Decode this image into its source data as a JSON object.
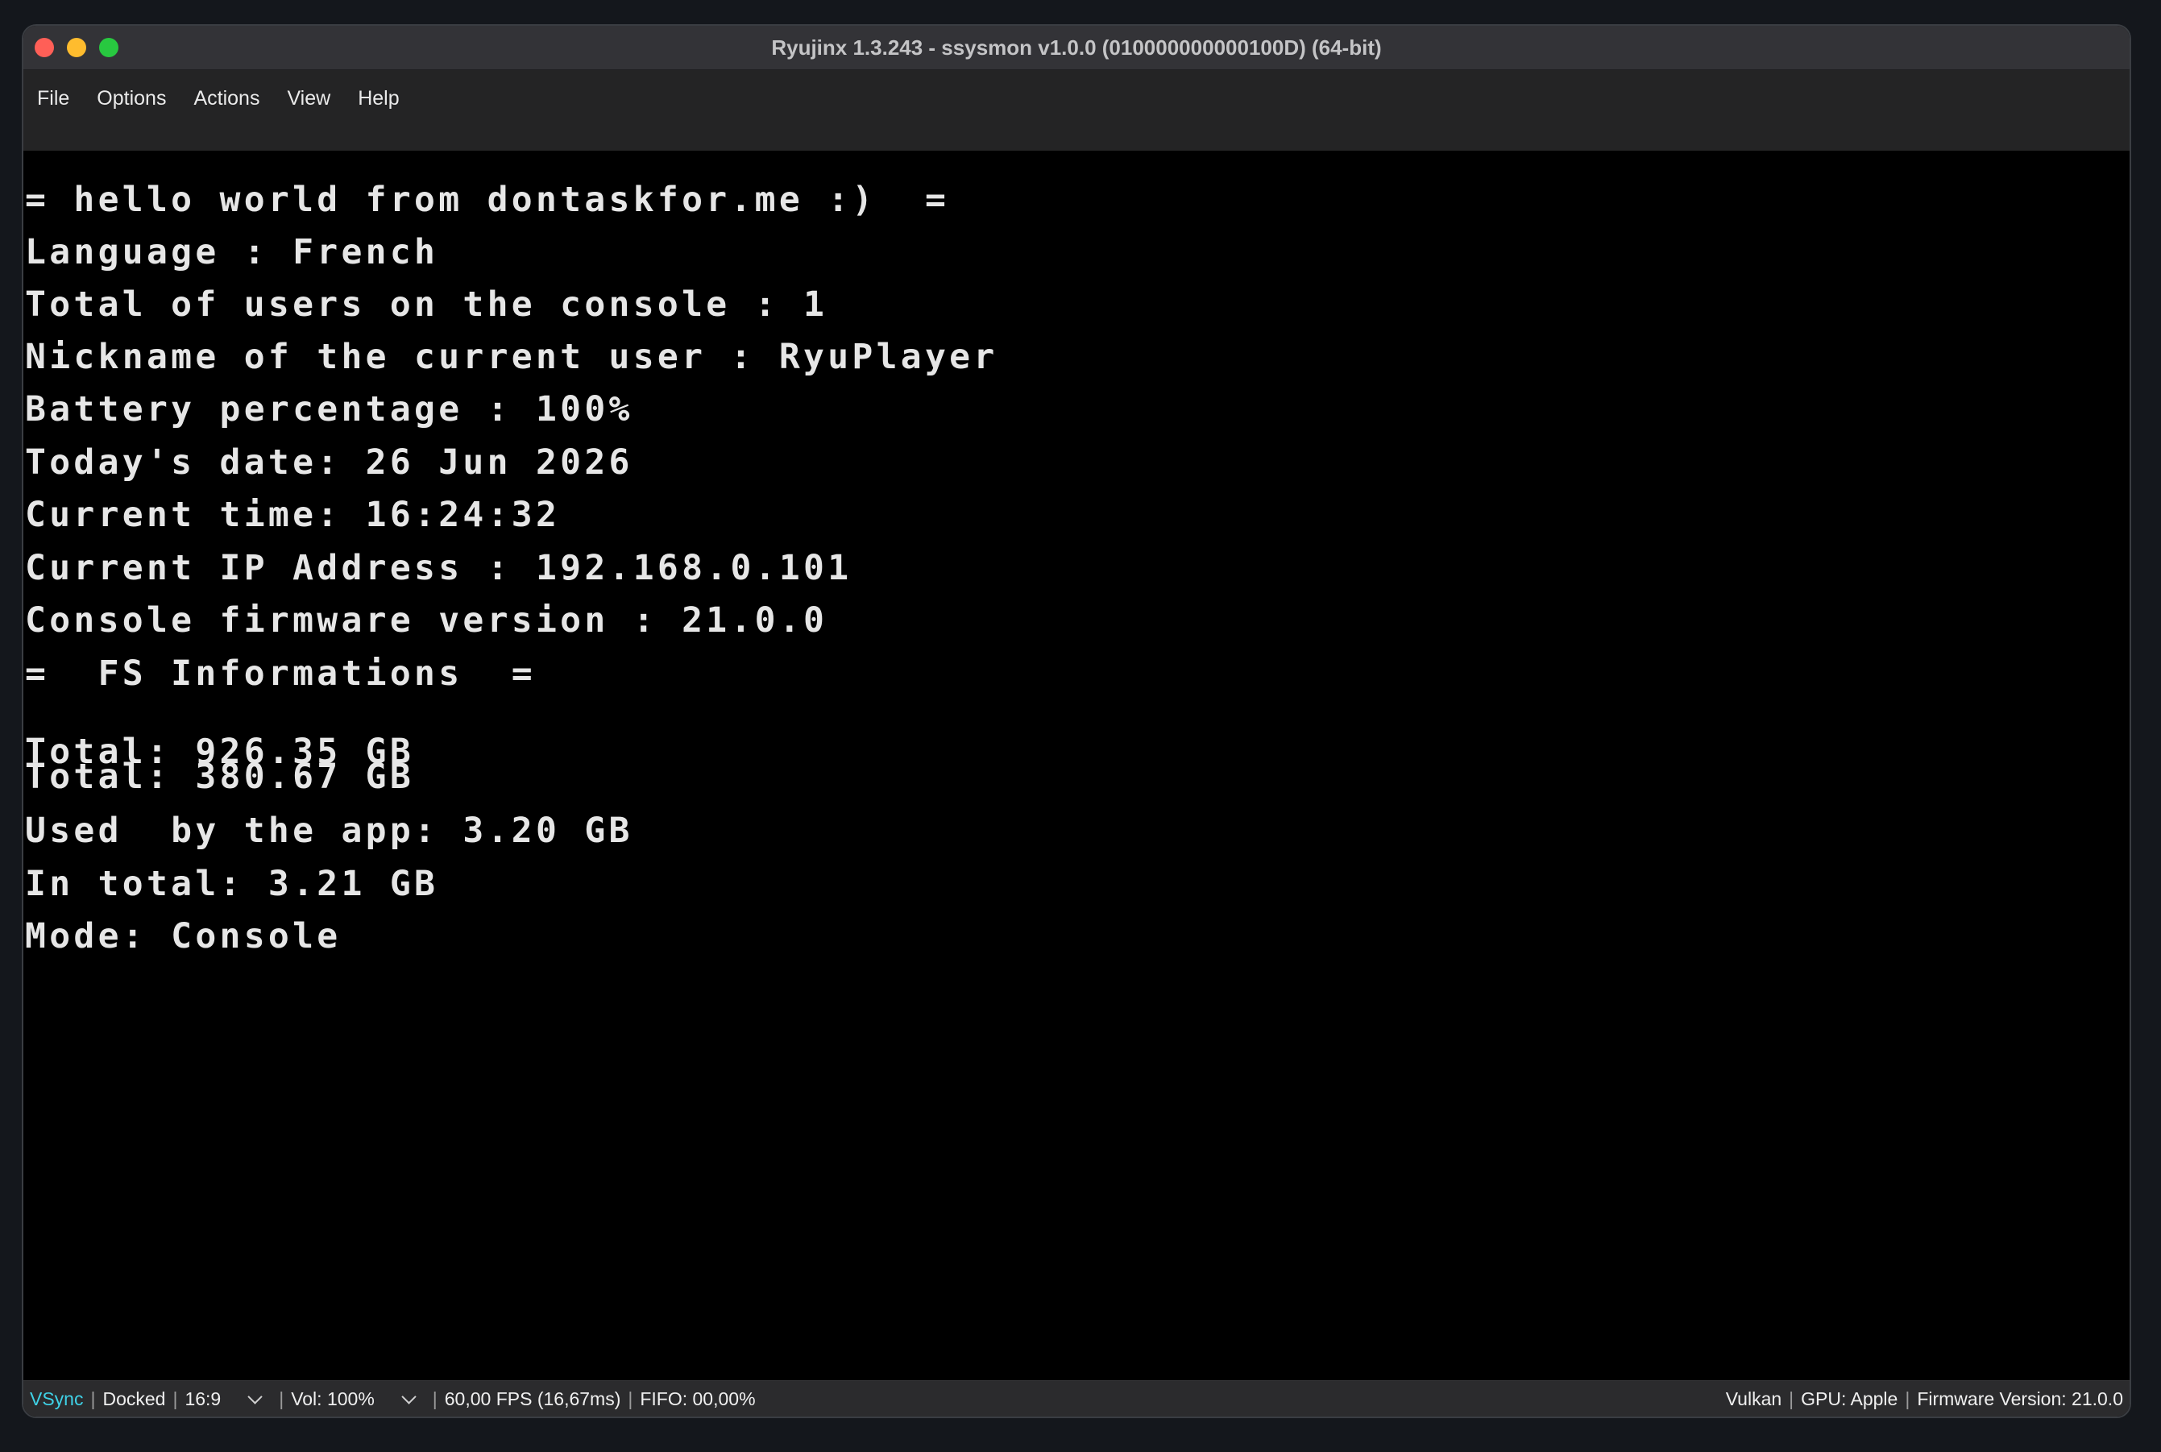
{
  "window": {
    "title": "Ryujinx 1.3.243 - ssysmon v1.0.0 (010000000000100D) (64-bit)"
  },
  "menu": {
    "items": [
      "File",
      "Options",
      "Actions",
      "View",
      "Help"
    ]
  },
  "console": {
    "lines": [
      "= hello world from dontaskfor.me :)  =",
      "Language : French",
      "Total of users on the console : 1",
      "Nickname of the current user : RyuPlayer",
      "Battery percentage : 100%",
      "Today's date: 26 Jun 2026",
      "Current time: 16:24:32",
      "Current IP Address : 192.168.0.101",
      "Console firmware version : 21.0.0",
      "=  FS Informations  =",
      "Total: 926.35 GB",
      "Total: 380.67 GB",
      "Used  by the app: 3.20 GB",
      "In total: 3.21 GB",
      "Mode: Console"
    ]
  },
  "status": {
    "vsync": "VSync",
    "dock": "Docked",
    "aspect": "16:9",
    "volume": "Vol: 100%",
    "fps": "60,00 FPS (16,67ms)",
    "fifo": "FIFO: 00,00%",
    "backend": "Vulkan",
    "gpu": "GPU: Apple",
    "firmware": "Firmware Version: 21.0.0",
    "separator": "|"
  },
  "colors": {
    "vsync_accent": "#3fd1e6",
    "console_text": "#e6e6e6",
    "close": "#ff5f57",
    "minimize": "#febc2e",
    "maximize": "#28c840"
  }
}
